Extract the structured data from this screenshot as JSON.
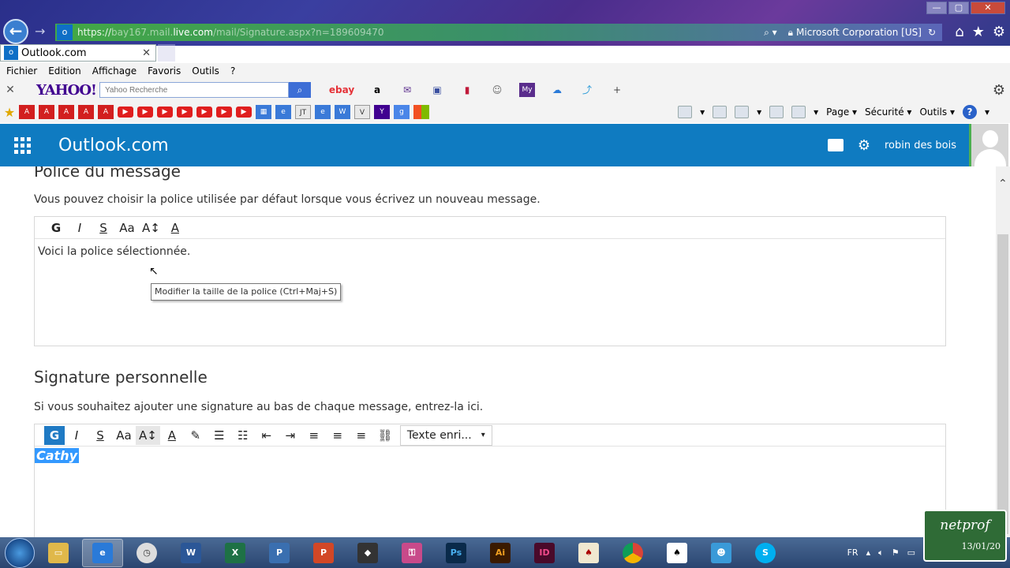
{
  "browser": {
    "url_prefix": "https://",
    "url_host_dim": "bay167.mail.",
    "url_host": "live.com",
    "url_path": "/mail/Signature.aspx?n=189609470",
    "cert": "Microsoft Corporation [US]",
    "tab_title": "Outlook.com",
    "menu": [
      "Fichier",
      "Edition",
      "Affichage",
      "Favoris",
      "Outils",
      "?"
    ],
    "yahoo_logo": "YAHOO!",
    "yahoo_placeholder": "Yahoo Recherche",
    "ebay": "ebay",
    "amazon": "a",
    "cmd": {
      "page": "Page ▾",
      "securite": "Sécurité ▾",
      "outils": "Outils ▾"
    }
  },
  "outlook": {
    "brand": "Outlook.com",
    "user": "robin des bois"
  },
  "section_font": {
    "heading": "Police du message",
    "description": "Vous pouvez choisir la police utilisée par défaut lorsque vous écrivez un nouveau message.",
    "sample": "Voici la police sélectionnée."
  },
  "section_signature": {
    "heading": "Signature personnelle",
    "description": "Si vous souhaitez ajouter une signature au bas de chaque message, entrez-la ici.",
    "font_select": "Texte enri...",
    "content": "Cathy",
    "tooltip": "Modifier la taille de la police (Ctrl+Maj+S)"
  },
  "toolbar_glyphs": {
    "bold": "G",
    "italic": "I",
    "strike": "S",
    "font": "Aa",
    "size": "A↕",
    "color": "A"
  },
  "taskbar": {
    "lang": "FR",
    "date": "13/01/20"
  },
  "watermark": "netprof"
}
